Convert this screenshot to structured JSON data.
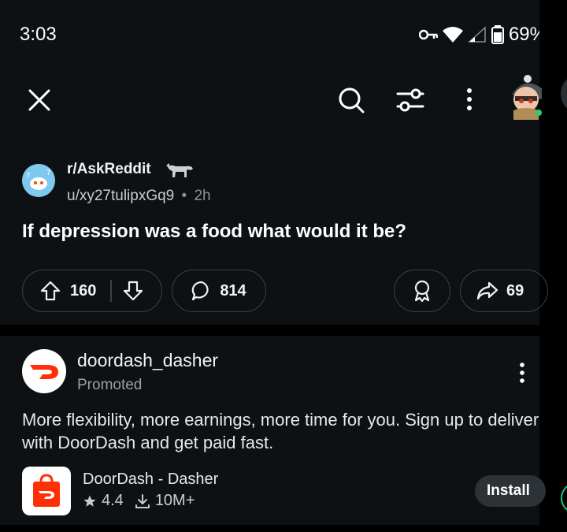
{
  "status_bar": {
    "time": "3:03",
    "battery": "69%"
  },
  "toolbar": {
    "icons": [
      "close-icon",
      "search-icon",
      "filter-icon",
      "more-vertical-icon",
      "avatar"
    ]
  },
  "post": {
    "subreddit": "r/AskReddit",
    "author": "u/xy27tulipxGq9",
    "separator": "•",
    "age": "2h",
    "title": "If depression was a food what would it be?",
    "upvotes": "160",
    "comments": "814",
    "shares": "69"
  },
  "ad": {
    "advertiser": "doordash_dasher",
    "promoted_label": "Promoted",
    "body": "More flexibility, more earnings, more time for you. Sign up to deliver with DoorDash and get paid fast.",
    "app_name": "DoorDash - Dasher",
    "rating": "4.4",
    "installs": "10M+",
    "install_label": "Install"
  },
  "colors": {
    "background": "#0e1113",
    "brand_red": "#ff3008",
    "pill_border": "#3a4044"
  }
}
